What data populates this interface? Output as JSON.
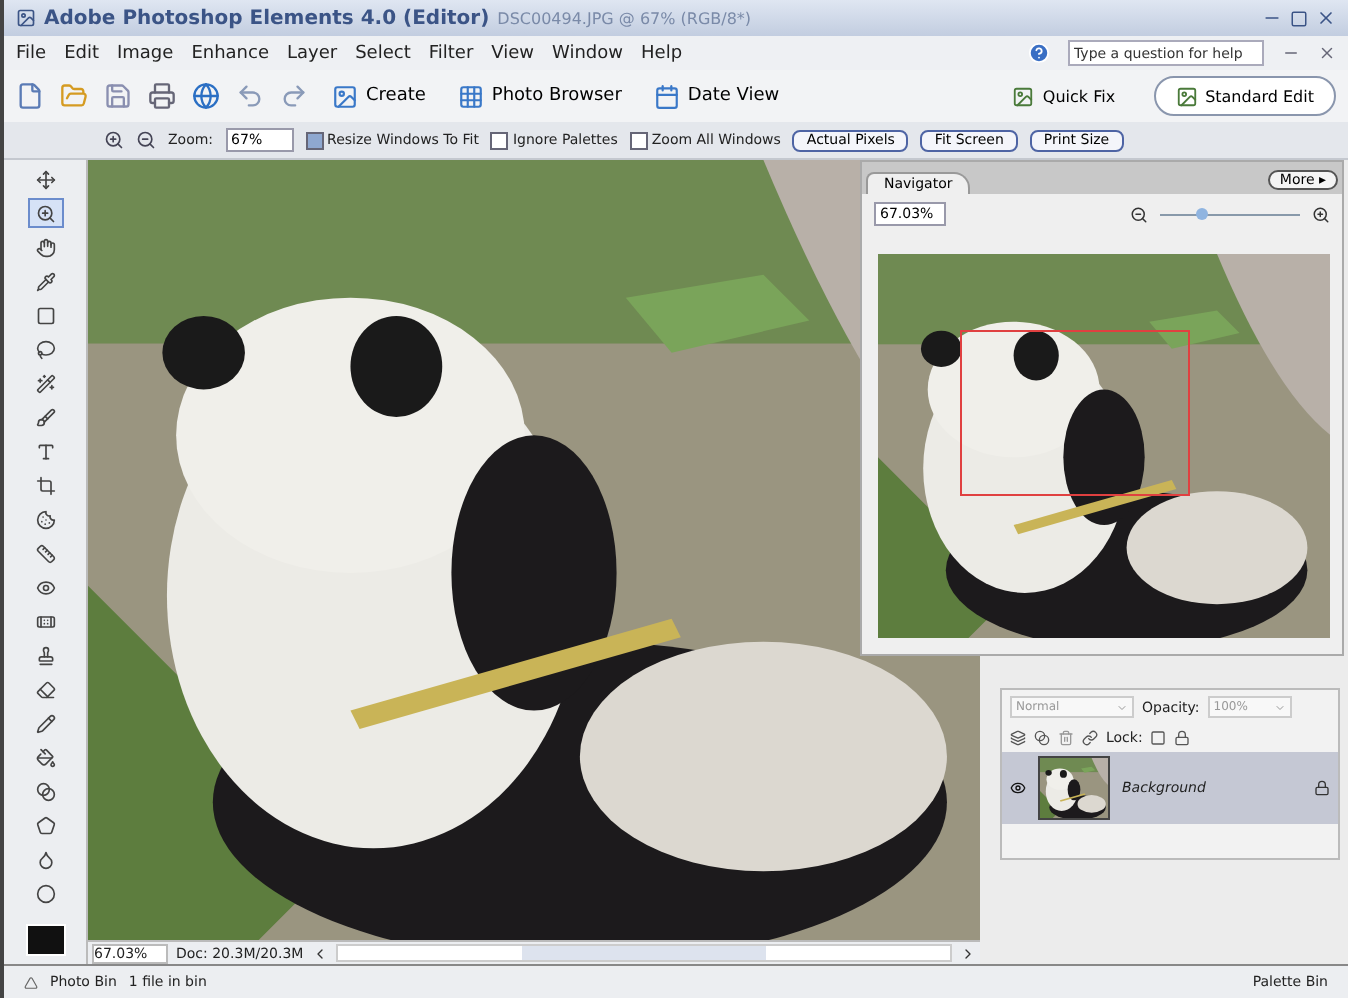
{
  "window": {
    "title": "Adobe Photoshop Elements 4.0 (Editor)",
    "document": "DSC00494.JPG @ 67% (RGB/8*)"
  },
  "menu": [
    "File",
    "Edit",
    "Image",
    "Enhance",
    "Layer",
    "Select",
    "Filter",
    "View",
    "Window",
    "Help"
  ],
  "help_field": {
    "placeholder": "Type a question for help"
  },
  "shortcuts": [
    {
      "label": "Create"
    },
    {
      "label": "Photo Browser"
    },
    {
      "label": "Date View"
    }
  ],
  "modes": [
    {
      "label": "Quick Fix",
      "selected": false
    },
    {
      "label": "Standard Edit",
      "selected": true
    }
  ],
  "options": {
    "zoom_label": "Zoom:",
    "zoom_value": "67%",
    "checks": [
      {
        "label": "Resize Windows To Fit",
        "checked": true
      },
      {
        "label": "Ignore Palettes",
        "checked": false
      },
      {
        "label": "Zoom All Windows",
        "checked": false
      }
    ],
    "buttons": [
      "Actual Pixels",
      "Fit Screen",
      "Print Size"
    ]
  },
  "tools": [
    {
      "kind": "move",
      "selected": false
    },
    {
      "kind": "zoom",
      "selected": true
    },
    {
      "kind": "hand",
      "selected": false
    },
    {
      "kind": "eyedropper",
      "selected": false
    },
    {
      "kind": "marquee",
      "selected": false
    },
    {
      "kind": "lasso",
      "selected": false
    },
    {
      "kind": "wand",
      "selected": false
    },
    {
      "kind": "brush",
      "selected": false
    },
    {
      "kind": "type",
      "selected": false
    },
    {
      "kind": "crop",
      "selected": false
    },
    {
      "kind": "cookie",
      "selected": false
    },
    {
      "kind": "straighten",
      "selected": false
    },
    {
      "kind": "redeye",
      "selected": false
    },
    {
      "kind": "healing",
      "selected": false
    },
    {
      "kind": "stamp",
      "selected": false
    },
    {
      "kind": "eraser",
      "selected": false
    },
    {
      "kind": "pencil",
      "selected": false
    },
    {
      "kind": "bucket",
      "selected": false
    },
    {
      "kind": "gradient",
      "selected": false
    },
    {
      "kind": "shape",
      "selected": false
    },
    {
      "kind": "blur",
      "selected": false
    },
    {
      "kind": "sponge",
      "selected": false
    }
  ],
  "status": {
    "zoom": "67.03%",
    "doc": "Doc: 20.3M/20.3M"
  },
  "navigator": {
    "tab": "Navigator",
    "more": "More ▸",
    "zoom": "67.03%",
    "level": 0.3
  },
  "layers": {
    "blend": "Normal",
    "opacity_label": "Opacity:",
    "opacity": "100%",
    "lock_label": "Lock:",
    "items": [
      {
        "name": "Background",
        "selected": true,
        "visible": true
      }
    ]
  },
  "bottom_bar": {
    "photo_bin": "Photo Bin",
    "files": "1 file in bin",
    "palette_bin": "Palette Bin"
  }
}
